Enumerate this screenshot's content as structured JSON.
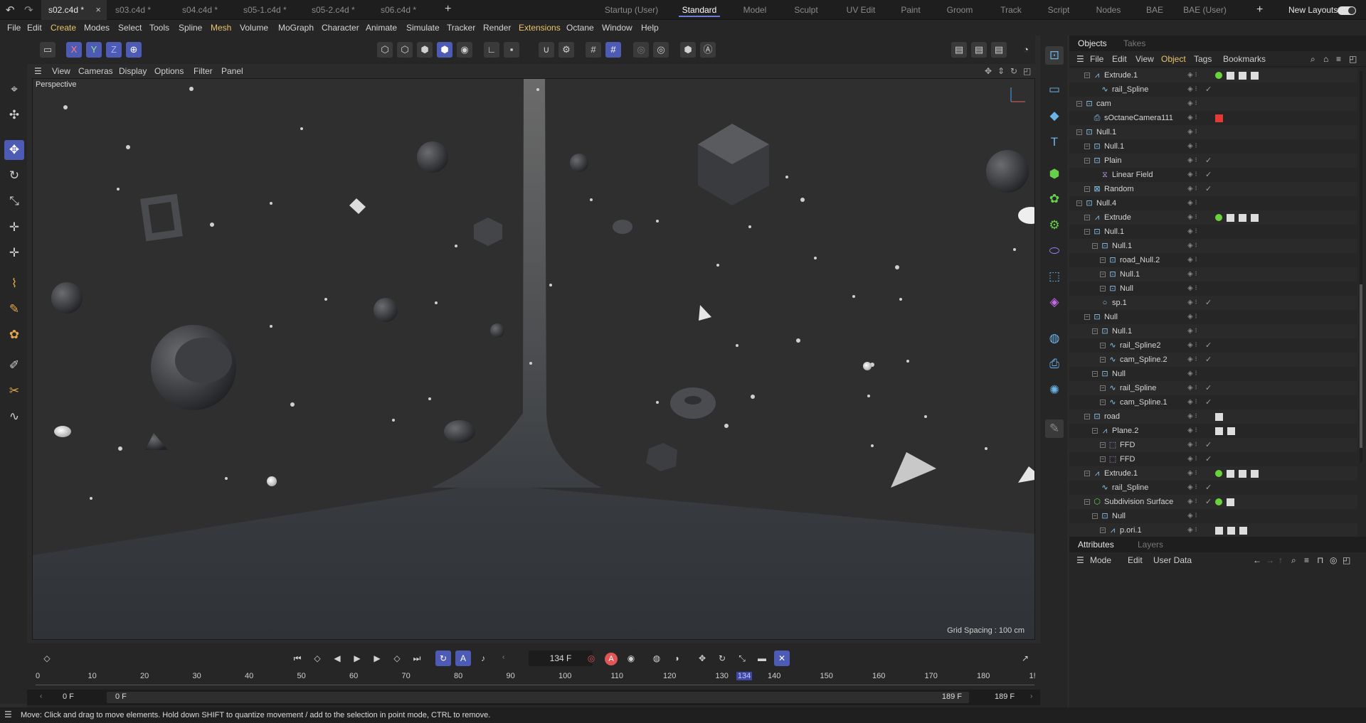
{
  "doc_tabs": [
    {
      "label": "s02.c4d *",
      "active": true
    },
    {
      "label": "s03.c4d *",
      "active": false
    },
    {
      "label": "s04.c4d *",
      "active": false
    },
    {
      "label": "s05-1.c4d *",
      "active": false
    },
    {
      "label": "s05-2.c4d *",
      "active": false
    },
    {
      "label": "s06.c4d *",
      "active": false
    }
  ],
  "layouts": [
    "Startup (User)",
    "Standard",
    "Model",
    "Sculpt",
    "UV Edit",
    "Paint",
    "Groom",
    "Track",
    "Script",
    "Nodes",
    "BAE",
    "BAE (User)"
  ],
  "new_layouts_label": "New Layouts",
  "menus": [
    "File",
    "Edit",
    "Create",
    "Modes",
    "Select",
    "Tools",
    "Spline",
    "Mesh",
    "Volume",
    "MoGraph",
    "Character",
    "Animate",
    "Simulate",
    "Tracker",
    "Render",
    "Extensions",
    "Octane",
    "Window",
    "Help"
  ],
  "axis_buttons": [
    "X",
    "Y",
    "Z"
  ],
  "viewport_menu": [
    "View",
    "Cameras",
    "Display",
    "Options",
    "Filter",
    "Panel"
  ],
  "viewport": {
    "label": "Perspective",
    "grid_spacing": "Grid Spacing : 100 cm"
  },
  "objects_panel": {
    "tabs": [
      "Objects",
      "Takes"
    ],
    "menu": [
      "File",
      "Edit",
      "View",
      "Object",
      "Tags",
      "Bookmarks"
    ],
    "rows": [
      {
        "name": "Extrude.1",
        "depth": 1,
        "icon": "extrude-icon"
      },
      {
        "name": "rail_Spline",
        "depth": 2,
        "icon": "spline-icon"
      },
      {
        "name": "cam",
        "depth": 0,
        "icon": "null-icon"
      },
      {
        "name": "sOctaneCamera111",
        "depth": 1,
        "icon": "camera-icon"
      },
      {
        "name": "Null.1",
        "depth": 0,
        "icon": "null-icon"
      },
      {
        "name": "Null.1",
        "depth": 1,
        "icon": "null-icon"
      },
      {
        "name": "Plain",
        "depth": 1,
        "icon": "null-icon"
      },
      {
        "name": "Linear Field",
        "depth": 2,
        "icon": "field-icon"
      },
      {
        "name": "Random",
        "depth": 1,
        "icon": "random-icon"
      },
      {
        "name": "Null.4",
        "depth": 0,
        "icon": "null-icon"
      },
      {
        "name": "Extrude",
        "depth": 1,
        "icon": "extrude-icon"
      },
      {
        "name": "Null.1",
        "depth": 1,
        "icon": "null-icon"
      },
      {
        "name": "Null.1",
        "depth": 2,
        "icon": "null-icon"
      },
      {
        "name": "road_Null.2",
        "depth": 3,
        "icon": "null-icon"
      },
      {
        "name": "Null.1",
        "depth": 3,
        "icon": "null-icon"
      },
      {
        "name": "Null",
        "depth": 3,
        "icon": "null-icon"
      },
      {
        "name": "sp.1",
        "depth": 2,
        "icon": "circle-icon"
      },
      {
        "name": "Null",
        "depth": 1,
        "icon": "null-icon"
      },
      {
        "name": "Null.1",
        "depth": 2,
        "icon": "null-icon"
      },
      {
        "name": "rail_Spline2",
        "depth": 3,
        "icon": "spline-icon"
      },
      {
        "name": "cam_Spline.2",
        "depth": 3,
        "icon": "spline-icon"
      },
      {
        "name": "Null",
        "depth": 2,
        "icon": "null-icon"
      },
      {
        "name": "rail_Spline",
        "depth": 3,
        "icon": "spline-icon"
      },
      {
        "name": "cam_Spline.1",
        "depth": 3,
        "icon": "spline-icon"
      },
      {
        "name": "road",
        "depth": 1,
        "icon": "null-icon"
      },
      {
        "name": "Plane.2",
        "depth": 2,
        "icon": "extrude-icon"
      },
      {
        "name": "FFD",
        "depth": 3,
        "icon": "ffd-icon"
      },
      {
        "name": "FFD",
        "depth": 3,
        "icon": "ffd-icon"
      },
      {
        "name": "Extrude.1",
        "depth": 1,
        "icon": "extrude-icon"
      },
      {
        "name": "rail_Spline",
        "depth": 2,
        "icon": "spline-icon"
      },
      {
        "name": "Subdivision Surface",
        "depth": 1,
        "icon": "subdivision-icon"
      },
      {
        "name": "Null",
        "depth": 2,
        "icon": "null-icon"
      },
      {
        "name": "p.ori.1",
        "depth": 3,
        "icon": "extrude-icon"
      }
    ]
  },
  "attributes_panel": {
    "tabs": [
      "Attributes",
      "Layers"
    ],
    "menu": [
      "Mode",
      "Edit",
      "User Data"
    ]
  },
  "timeline": {
    "current_frame": "134 F",
    "ruler_ticks": [
      "0",
      "10",
      "20",
      "30",
      "40",
      "50",
      "60",
      "70",
      "80",
      "90",
      "100",
      "110",
      "120",
      "130",
      "134",
      "140",
      "150",
      "160",
      "170",
      "180",
      "1!"
    ],
    "playhead": "134",
    "range_start": "0 F",
    "range_start_inner": "0 F",
    "range_end_inner": "189 F",
    "range_end": "189 F"
  },
  "status_text": "Move: Click and drag to move elements. Hold down SHIFT to quantize movement / add to the selection in point mode, CTRL to remove.",
  "colors": {
    "accent": "#4d5bb5",
    "menu_accent": "#e9c46a",
    "tag_green": "#6ad23a",
    "icon_blue": "#6ab4ea"
  }
}
